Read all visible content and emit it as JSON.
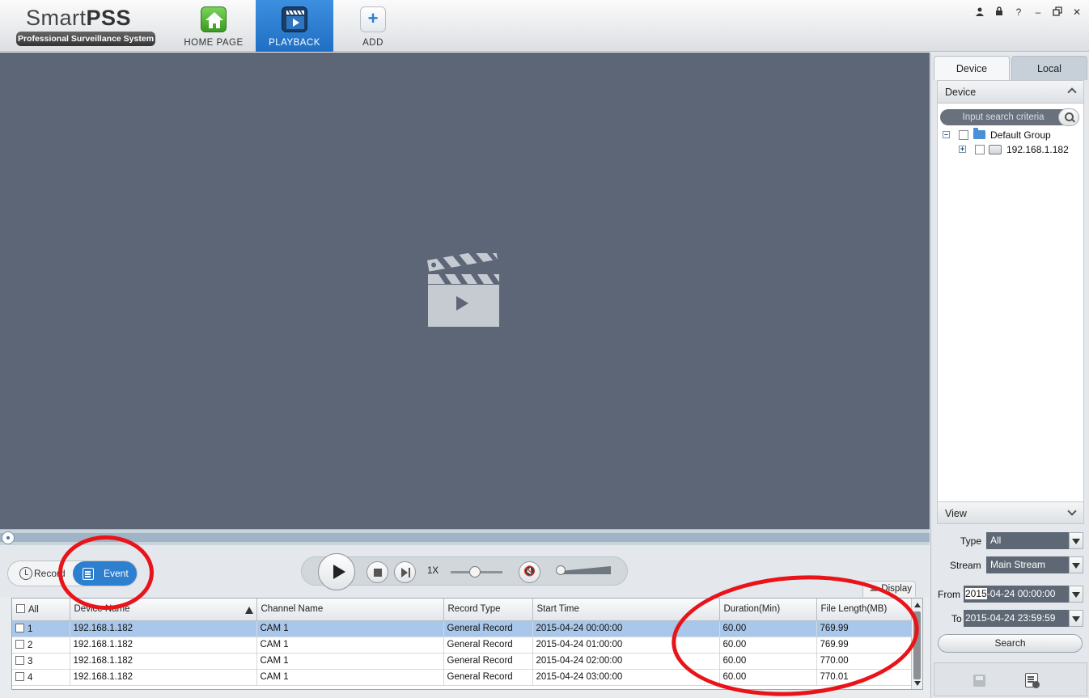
{
  "app": {
    "logo_main": "Smart",
    "logo_bold": "PSS",
    "logo_sub": "Professional Surveillance System"
  },
  "nav": {
    "home": "HOME PAGE",
    "playback": "PLAYBACK",
    "add": "ADD"
  },
  "window_controls": [
    "user-icon",
    "lock-icon",
    "help-icon",
    "minimize-icon",
    "restore-icon",
    "close-icon"
  ],
  "playback": {
    "mode_record": "Record",
    "mode_event": "Event",
    "speed": "1X",
    "speed_slider": 0.45,
    "volume_slider": 0.0
  },
  "table": {
    "display_label": "Display",
    "columns": [
      "All",
      "Device Name",
      "Channel Name",
      "Record Type",
      "Start Time",
      "Duration(Min)",
      "File Length(MB)"
    ],
    "rows": [
      {
        "idx": "1",
        "device": "192.168.1.182",
        "channel": "CAM 1",
        "type": "General Record",
        "start": "2015-04-24 00:00:00",
        "duration": "60.00",
        "length": "769.99"
      },
      {
        "idx": "2",
        "device": "192.168.1.182",
        "channel": "CAM 1",
        "type": "General Record",
        "start": "2015-04-24 01:00:00",
        "duration": "60.00",
        "length": "769.99"
      },
      {
        "idx": "3",
        "device": "192.168.1.182",
        "channel": "CAM 1",
        "type": "General Record",
        "start": "2015-04-24 02:00:00",
        "duration": "60.00",
        "length": "770.00"
      },
      {
        "idx": "4",
        "device": "192.168.1.182",
        "channel": "CAM 1",
        "type": "General Record",
        "start": "2015-04-24 03:00:00",
        "duration": "60.00",
        "length": "770.01"
      }
    ]
  },
  "right_panel": {
    "tab_device": "Device",
    "tab_local": "Local",
    "device_section": "Device",
    "search_placeholder": "Input search criteria",
    "tree_group": "Default Group",
    "tree_device": "192.168.1.182",
    "view_section": "View",
    "type_label": "Type",
    "type_value": "All",
    "stream_label": "Stream",
    "stream_value": "Main Stream",
    "from_label": "From",
    "from_year": "2015",
    "from_rest": "-04-24 00:00:00",
    "to_label": "To",
    "to_value": "2015-04-24 23:59:59",
    "search_button": "Search"
  },
  "colors": {
    "accent": "#2d7fcf",
    "video_bg": "#5d6677",
    "selected_row": "#a9c7ea",
    "annotation": "#e8141a"
  }
}
